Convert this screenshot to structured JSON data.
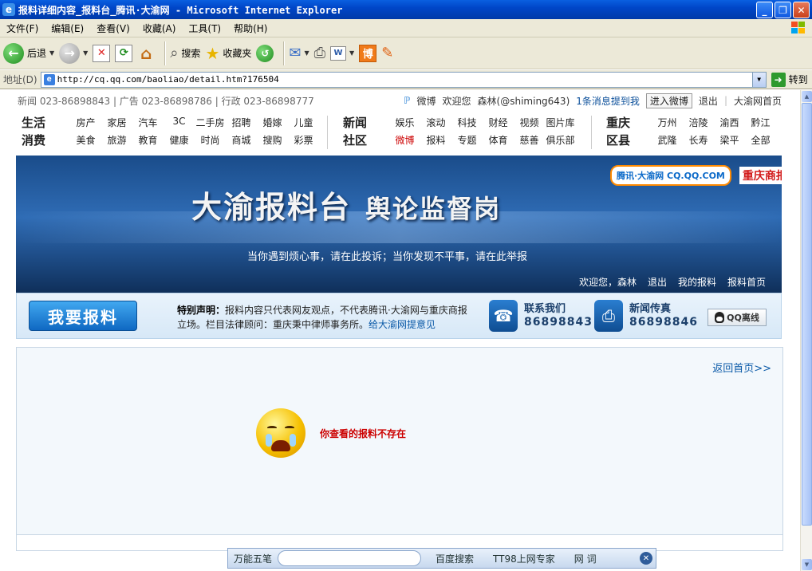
{
  "window": {
    "title": "报料详细内容_报料台_腾讯·大渝网 - Microsoft Internet Explorer"
  },
  "menu": [
    "文件(F)",
    "编辑(E)",
    "查看(V)",
    "收藏(A)",
    "工具(T)",
    "帮助(H)"
  ],
  "toolbar": {
    "back_label": "后退",
    "search_label": "搜索",
    "favorites_label": "收藏夹"
  },
  "address": {
    "label": "地址(D)",
    "url": "http://cq.qq.com/baoliao/detail.htm?176504",
    "go_label": "转到"
  },
  "site": {
    "top_left": "新闻 023-86898843 | 广告 023-86898786 | 行政 023-86898777",
    "weibo_label": "微博",
    "welcome": "欢迎您",
    "user": "森林(@shiming643)",
    "mentions": "1条消息提到我",
    "enter_weibo": "进入微博",
    "logout": "退出",
    "home_link": "大渝网首页"
  },
  "nav": {
    "group1_head": "生活消费",
    "group1_row1": [
      "房产",
      "家居",
      "汽车",
      "3C",
      "二手房",
      "招聘",
      "婚嫁",
      "儿童"
    ],
    "group1_row2": [
      "美食",
      "旅游",
      "教育",
      "健康",
      "时尚",
      "商城",
      "搜购",
      "彩票"
    ],
    "group2_head": "新闻社区",
    "group2_row1": [
      "娱乐",
      "滚动",
      "科技",
      "财经",
      "视频",
      "图片库"
    ],
    "group2_row2": [
      "微博",
      "报料",
      "专题",
      "体育",
      "慈善",
      "俱乐部"
    ],
    "group3_head": "重庆区县",
    "group3_row1": [
      "万州",
      "涪陵",
      "渝西",
      "黔江"
    ],
    "group3_row2": [
      "武隆",
      "长寿",
      "梁平",
      "全部"
    ]
  },
  "banner": {
    "title_main": "大渝报料台",
    "title_sub": "舆论监督岗",
    "slogan": "当你遇到烦心事，请在此投诉；当你发现不平事，请在此举报",
    "logo1": "腾讯·大渝网 CQ.QQ.COM",
    "logo2": "重庆商报",
    "nav": [
      "欢迎您，森林",
      "退出",
      "我的报料",
      "报料首页"
    ]
  },
  "infobar": {
    "report_button": "我要报料",
    "statement_bold": "特别声明：",
    "statement_text": "报料内容只代表网友观点，不代表腾讯·大渝网与重庆商报立场。栏目法律顾问：重庆秉中律师事务所。",
    "statement_link": "给大渝网提意见",
    "contact_label": "联系我们",
    "contact_number": "86898843",
    "fax_label": "新闻传真",
    "fax_number": "86898846",
    "qq_button": "QQ离线"
  },
  "content": {
    "back_link": "返回首页>>",
    "error_message": "你查看的报料不存在"
  },
  "ime": {
    "name": "万能五笔",
    "items": [
      "百度搜索",
      "TT98上网专家",
      "网 词"
    ]
  }
}
